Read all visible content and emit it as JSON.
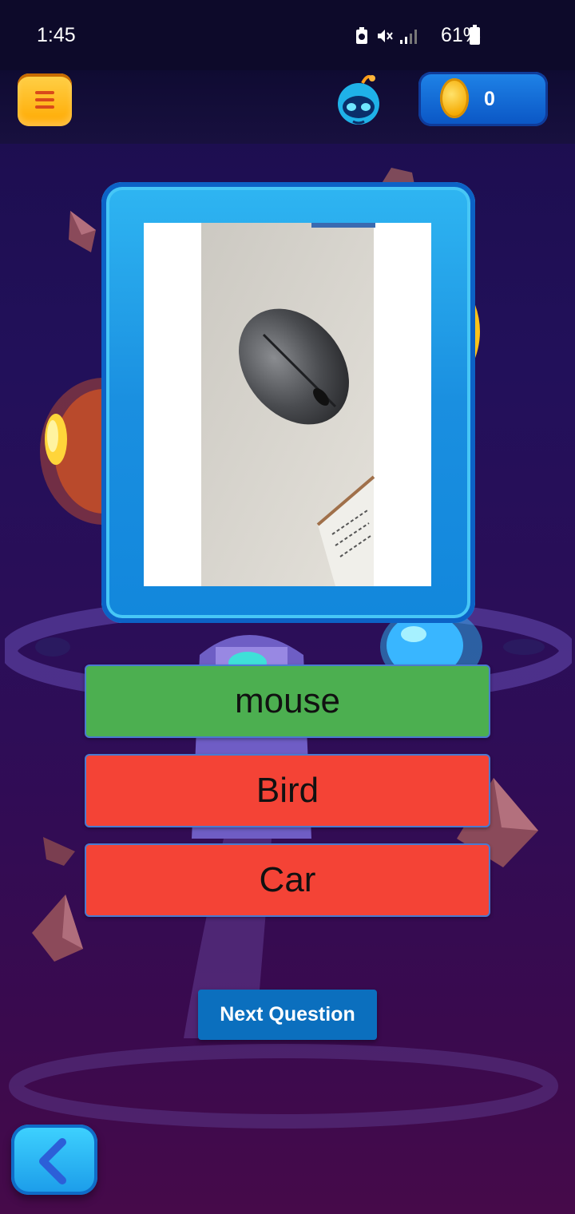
{
  "status": {
    "time": "1:45",
    "battery": "61%",
    "icons": [
      "battery-saver-icon",
      "mute-icon",
      "signal-icon"
    ]
  },
  "header": {
    "menu_icon": "menu-icon",
    "avatar_icon": "alien-avatar-icon",
    "coins": "0",
    "coin_icon": "coin-icon"
  },
  "quiz": {
    "image_alt": "photo of a computer mouse on a desk",
    "answers": [
      {
        "label": "mouse",
        "state": "correct",
        "color": "#4caf50"
      },
      {
        "label": "Bird",
        "state": "wrong",
        "color": "#f44336"
      },
      {
        "label": "Car",
        "state": "wrong",
        "color": "#f44336"
      }
    ],
    "next_label": "Next Question"
  },
  "nav": {
    "back_icon": "chevron-left-icon"
  }
}
